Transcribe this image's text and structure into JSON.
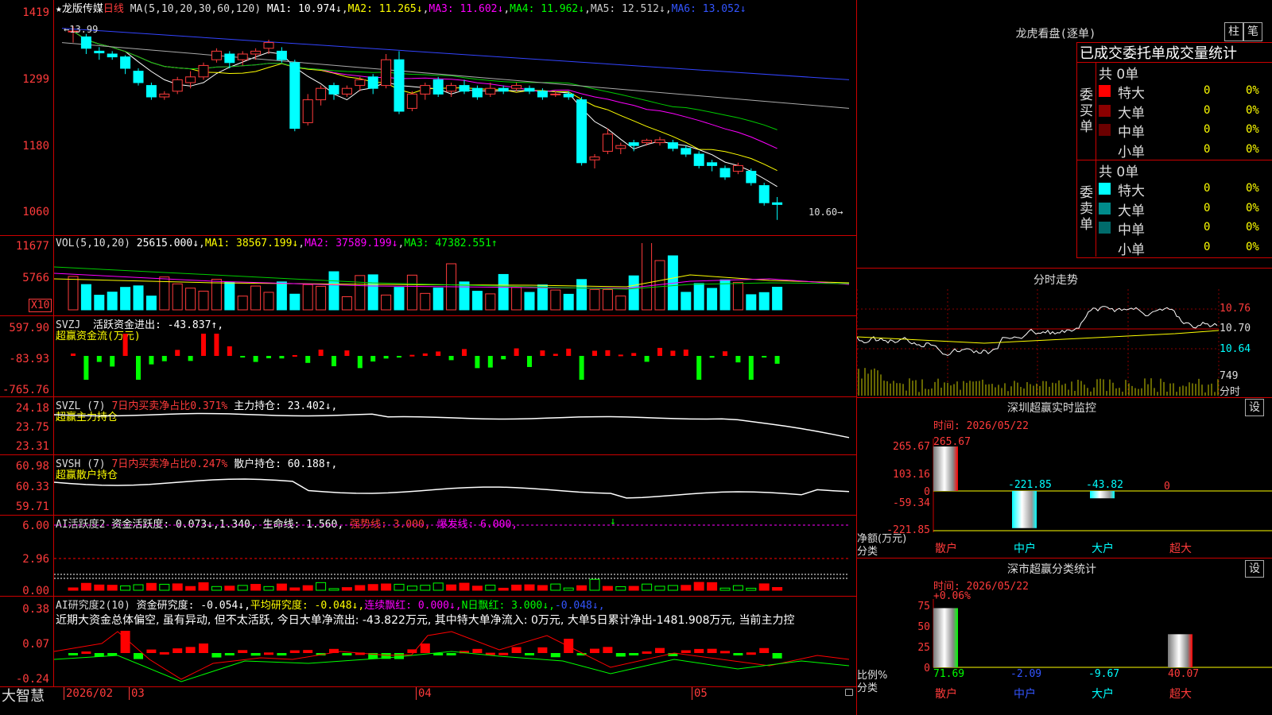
{
  "main_panel": {
    "header": {
      "star": "★",
      "name": "龙版传媒",
      "period": "日线",
      "ma_label": "MA(5,10,20,30,60,120)",
      "ma1": "MA1: 10.974↓",
      "ma2": "MA2: 11.265↓",
      "ma3": "MA3: 11.602↓",
      "ma4": "MA4: 11.962↓",
      "ma5": "MA5: 12.512↓",
      "ma6": "MA6: 13.052↓"
    },
    "y_labels": [
      "1419",
      "1299",
      "1180",
      "1060"
    ],
    "high_mark": "13.99",
    "low_mark": "10.60"
  },
  "vol_panel": {
    "title": "VOL(5,10,20)",
    "value": "25615.000↓",
    "ma1": "MA1: 38567.199↓",
    "ma2": "MA2: 37589.199↓",
    "ma3": "MA3: 47382.551↑",
    "y_labels": [
      "11677",
      "5766"
    ],
    "unit": "X10"
  },
  "svzj_panel": {
    "title": "SVZJ",
    "label": "活跃资金进出: -43.837↑,",
    "sub": "超赢资金流(万元)",
    "y_labels": [
      "597.90",
      "-83.93",
      "-765.76"
    ]
  },
  "svzl_panel": {
    "title": "SVZL (7)",
    "ratio": "7日内买卖净占比0.371%",
    "hold": "主力持仓: 23.402↓,",
    "sub": "超赢主力持仓",
    "y_labels": [
      "24.18",
      "23.75",
      "23.31"
    ]
  },
  "svsh_panel": {
    "title": "SVSH (7)",
    "ratio": "7日内买卖净占比0.247%",
    "hold": "散户持仓: 60.188↑,",
    "sub": "超赢散户持仓",
    "y_labels": [
      "60.98",
      "60.33",
      "59.71"
    ]
  },
  "ai_active_panel": {
    "title": "AI活跃度2",
    "v1": "资金活跃度: 0.073↓,1.340,",
    "v2": "生命线: 1.560,",
    "v3": "强势线: 3.000,",
    "v4": "爆发线: 6.000,",
    "arrow": "↓",
    "y_labels": [
      "6.00",
      "2.96",
      "0.00"
    ]
  },
  "ai_research_panel": {
    "title": "AI研究度2(10)",
    "v1": "资金研究度: -0.054↓,",
    "v2": "平均研究度: -0.048↓,",
    "v3": "连续飘红: 0.000↓,",
    "v4": "N日飘红: 3.000↓,",
    "v5": "-0.048↓,",
    "comment": "近期大资金总体偏空, 虽有异动, 但不太活跃, 今日大单净流出: -43.822万元, 其中特大单净流入: 0万元, 大单5日累计净出-1481.908万元, 当前主力控",
    "y_labels": [
      "0.38",
      "0.07",
      "-0.24"
    ]
  },
  "timeline": {
    "brand": "大智慧",
    "labels": [
      "2026/02",
      "03",
      "04",
      "05"
    ]
  },
  "dragon_tiger": {
    "title": "龙虎看盘(逐单)",
    "btn_bar": "柱",
    "btn_pen": "笔",
    "tabs_label": "已成交委托单成交量统计",
    "buy": {
      "vert_label": "委买单",
      "total": "共 0单",
      "rows": [
        {
          "label": "特大",
          "value": "0",
          "pct": "0%",
          "color": "#ff0000"
        },
        {
          "label": "大单",
          "value": "0",
          "pct": "0%",
          "color": "#8b0000"
        },
        {
          "label": "中单",
          "value": "0",
          "pct": "0%",
          "color": "#6b0000"
        },
        {
          "label": "小单",
          "value": "0",
          "pct": "0%",
          "color": "#000000"
        }
      ]
    },
    "sell": {
      "vert_label": "委卖单",
      "total": "共 0单",
      "rows": [
        {
          "label": "特大",
          "value": "0",
          "pct": "0%",
          "color": "#00ffff"
        },
        {
          "label": "大单",
          "value": "0",
          "pct": "0%",
          "color": "#008b8b"
        },
        {
          "label": "中单",
          "value": "0",
          "pct": "0%",
          "color": "#006b6b"
        },
        {
          "label": "小单",
          "value": "0",
          "pct": "0%",
          "color": "#000000"
        }
      ]
    }
  },
  "intraday": {
    "title": "分时走势",
    "y_labels": [
      "10.76",
      "10.70",
      "10.64"
    ],
    "vol_label": "749",
    "vol_unit": "分时"
  },
  "monitor": {
    "title": "深圳超赢实时监控",
    "btn": "设",
    "time_label": "时间: 2026/05/22",
    "y_labels": [
      "265.67",
      "103.16",
      "0",
      "-59.34",
      "-221.85"
    ],
    "axis_title": "净额(万元)",
    "axis_sub": "分类",
    "bars": [
      {
        "cat": "散户",
        "value": 265.67,
        "label": "265.67"
      },
      {
        "cat": "中户",
        "value": -221.85,
        "label": "-221.85"
      },
      {
        "cat": "大户",
        "value": -43.82,
        "label": "-43.82"
      },
      {
        "cat": "超大",
        "value": 0,
        "label": "0"
      }
    ]
  },
  "classify": {
    "title": "深市超赢分类统计",
    "btn": "设",
    "time_label": "时间: 2026/05/22",
    "top_label": "+0.06%",
    "y_labels": [
      "75",
      "50",
      "25",
      "0"
    ],
    "axis_title": "比例%",
    "axis_sub": "分类",
    "bars": [
      {
        "cat": "散户",
        "value": 71.69,
        "label": "71.69"
      },
      {
        "cat": "中户",
        "value": -2.09,
        "label": "-2.09"
      },
      {
        "cat": "大户",
        "value": -9.67,
        "label": "-9.67"
      },
      {
        "cat": "超大",
        "value": 40.07,
        "label": "40.07"
      }
    ]
  },
  "chart_data": {
    "type": "candlestick",
    "xlabel": "",
    "ylabel": "",
    "ylim": [
      10.5,
      14.25
    ],
    "candles": [
      [
        13.9,
        13.9,
        13.7,
        13.99
      ],
      [
        13.8,
        13.6,
        13.5,
        13.85
      ],
      [
        13.55,
        13.52,
        13.4,
        13.62
      ],
      [
        13.5,
        13.45,
        13.4,
        13.55
      ],
      [
        13.45,
        13.25,
        13.15,
        13.48
      ],
      [
        13.2,
        13.0,
        12.95,
        13.25
      ],
      [
        12.95,
        12.75,
        12.7,
        13.0
      ],
      [
        12.75,
        12.8,
        12.7,
        12.85
      ],
      [
        12.85,
        13.05,
        12.8,
        13.1
      ],
      [
        13.0,
        13.1,
        12.9,
        13.2
      ],
      [
        13.1,
        13.3,
        13.05,
        13.35
      ],
      [
        13.4,
        13.55,
        13.35,
        13.6
      ],
      [
        13.5,
        13.35,
        13.25,
        13.55
      ],
      [
        13.4,
        13.5,
        13.3,
        13.55
      ],
      [
        13.5,
        13.55,
        13.4,
        13.6
      ],
      [
        13.6,
        13.7,
        13.5,
        13.75
      ],
      [
        13.55,
        13.4,
        13.35,
        13.62
      ],
      [
        13.35,
        12.2,
        12.15,
        13.4
      ],
      [
        12.3,
        12.7,
        12.25,
        12.8
      ],
      [
        12.7,
        12.9,
        12.6,
        12.95
      ],
      [
        12.95,
        12.8,
        12.7,
        13.0
      ],
      [
        12.8,
        12.9,
        12.75,
        12.95
      ],
      [
        12.95,
        13.05,
        12.85,
        13.1
      ],
      [
        13.1,
        12.9,
        12.8,
        13.15
      ],
      [
        12.95,
        13.4,
        12.9,
        13.5
      ],
      [
        13.4,
        12.5,
        12.45,
        13.55
      ],
      [
        12.55,
        12.8,
        12.5,
        12.85
      ],
      [
        12.8,
        12.95,
        12.7,
        13.0
      ],
      [
        13.05,
        12.8,
        12.75,
        13.1
      ],
      [
        12.85,
        12.95,
        12.75,
        13.0
      ],
      [
        12.95,
        12.85,
        12.8,
        13.05
      ],
      [
        12.9,
        12.75,
        12.7,
        12.95
      ],
      [
        12.8,
        12.9,
        12.75,
        13.0
      ],
      [
        12.9,
        12.85,
        12.8,
        12.95
      ],
      [
        12.9,
        12.95,
        12.85,
        13.0
      ],
      [
        12.9,
        12.85,
        12.8,
        12.95
      ],
      [
        12.85,
        12.75,
        12.7,
        12.9
      ],
      [
        12.8,
        12.8,
        12.75,
        12.85
      ],
      [
        12.8,
        12.75,
        12.7,
        12.85
      ],
      [
        12.7,
        11.6,
        11.55,
        12.75
      ],
      [
        11.65,
        11.7,
        11.5,
        11.75
      ],
      [
        11.8,
        12.1,
        11.75,
        12.2
      ],
      [
        11.85,
        11.9,
        11.75,
        11.95
      ],
      [
        11.95,
        11.9,
        11.8,
        12.0
      ],
      [
        11.95,
        11.99,
        11.9,
        12.02
      ],
      [
        11.95,
        12.0,
        11.9,
        12.05
      ],
      [
        11.95,
        11.85,
        11.8,
        12.0
      ],
      [
        11.85,
        11.75,
        11.7,
        11.9
      ],
      [
        11.75,
        11.55,
        11.5,
        11.8
      ],
      [
        11.6,
        11.55,
        11.45,
        11.65
      ],
      [
        11.5,
        11.35,
        11.3,
        11.55
      ],
      [
        11.45,
        11.55,
        11.4,
        11.6
      ],
      [
        11.45,
        11.25,
        11.2,
        11.5
      ],
      [
        11.2,
        10.9,
        10.85,
        11.25
      ],
      [
        10.9,
        10.87,
        10.6,
        11.0
      ]
    ]
  }
}
